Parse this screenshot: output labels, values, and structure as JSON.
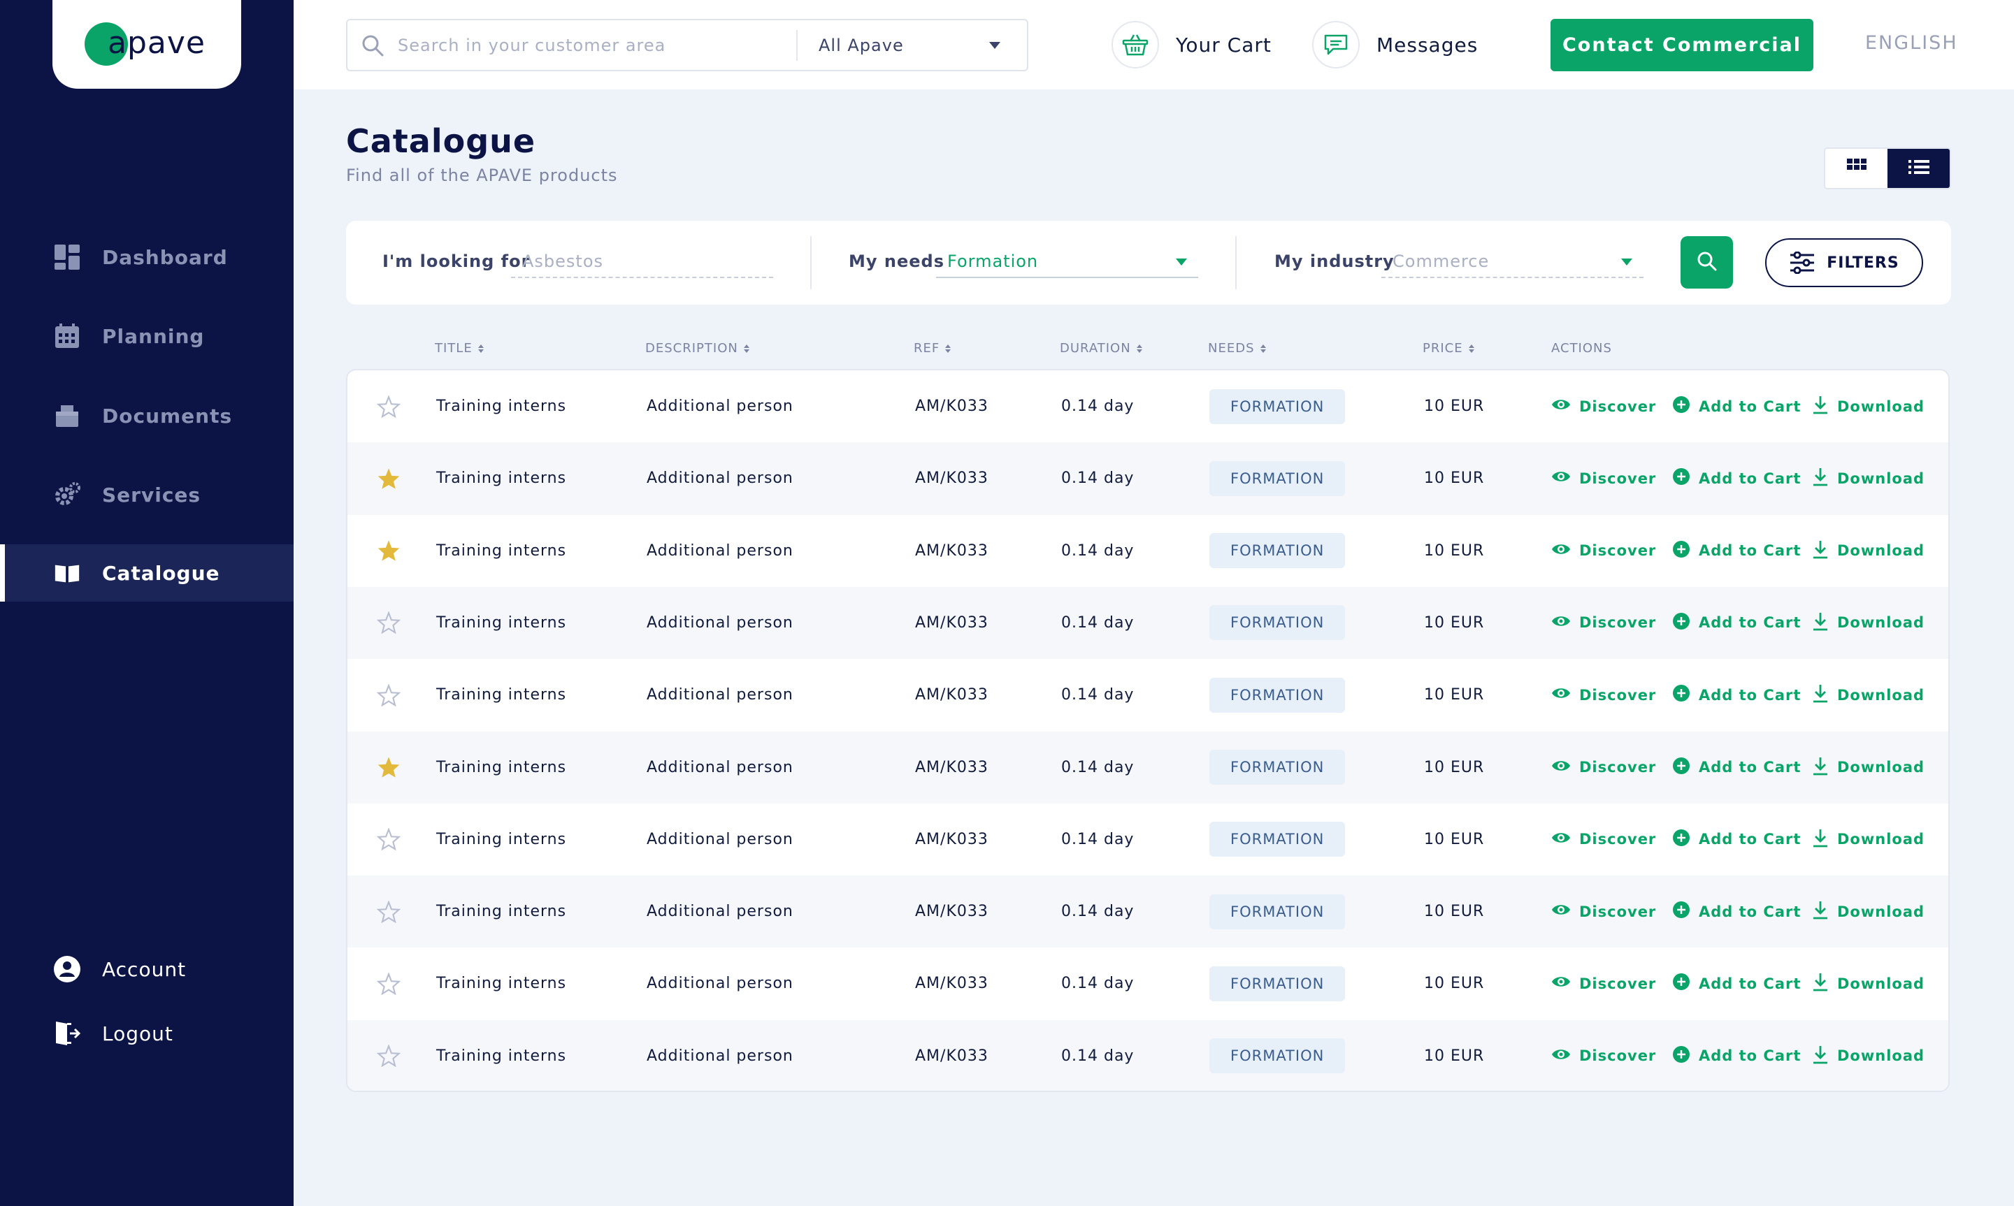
{
  "brand": {
    "logo_text": "apave"
  },
  "sidebar": {
    "items": [
      {
        "label": "Dashboard",
        "icon": "dashboard-icon"
      },
      {
        "label": "Planning",
        "icon": "calendar-icon"
      },
      {
        "label": "Documents",
        "icon": "documents-icon"
      },
      {
        "label": "Services",
        "icon": "gear-icon"
      },
      {
        "label": "Catalogue",
        "icon": "book-icon",
        "active": true
      }
    ],
    "bottom": [
      {
        "label": "Account",
        "icon": "user-icon"
      },
      {
        "label": "Logout",
        "icon": "logout-icon"
      }
    ]
  },
  "header": {
    "search_placeholder": "Search in your customer area",
    "scope": "All Apave",
    "cart_label": "Your Cart",
    "messages_label": "Messages",
    "contact_label": "Contact Commercial",
    "language": "ENGLISH"
  },
  "page": {
    "title": "Catalogue",
    "subtitle": "Find all of the APAVE products"
  },
  "filters": {
    "looking_label": "I'm looking for",
    "looking_placeholder": "Asbestos",
    "needs_label": "My needs",
    "needs_value": "Formation",
    "industry_label": "My industry",
    "industry_placeholder": "Commerce",
    "filters_label": "FILTERS"
  },
  "table": {
    "columns": {
      "title": "TITLE",
      "description": "DESCRIPTION",
      "ref": "REF",
      "duration": "DURATION",
      "needs": "NEEDS",
      "price": "PRICE",
      "actions": "ACTIONS"
    },
    "action_labels": {
      "discover": "Discover",
      "add": "Add to Cart",
      "download": "Download"
    },
    "rows": [
      {
        "starred": false,
        "title": "Training interns",
        "description": "Additional person",
        "ref": "AM/K033",
        "duration": "0.14 day",
        "needs": "FORMATION",
        "price": "10 EUR"
      },
      {
        "starred": true,
        "title": "Training interns",
        "description": "Additional person",
        "ref": "AM/K033",
        "duration": "0.14 day",
        "needs": "FORMATION",
        "price": "10 EUR"
      },
      {
        "starred": true,
        "title": "Training interns",
        "description": "Additional person",
        "ref": "AM/K033",
        "duration": "0.14 day",
        "needs": "FORMATION",
        "price": "10 EUR"
      },
      {
        "starred": false,
        "title": "Training interns",
        "description": "Additional person",
        "ref": "AM/K033",
        "duration": "0.14 day",
        "needs": "FORMATION",
        "price": "10 EUR"
      },
      {
        "starred": false,
        "title": "Training interns",
        "description": "Additional person",
        "ref": "AM/K033",
        "duration": "0.14 day",
        "needs": "FORMATION",
        "price": "10 EUR"
      },
      {
        "starred": true,
        "title": "Training interns",
        "description": "Additional person",
        "ref": "AM/K033",
        "duration": "0.14 day",
        "needs": "FORMATION",
        "price": "10 EUR"
      },
      {
        "starred": false,
        "title": "Training interns",
        "description": "Additional person",
        "ref": "AM/K033",
        "duration": "0.14 day",
        "needs": "FORMATION",
        "price": "10 EUR"
      },
      {
        "starred": false,
        "title": "Training interns",
        "description": "Additional person",
        "ref": "AM/K033",
        "duration": "0.14 day",
        "needs": "FORMATION",
        "price": "10 EUR"
      },
      {
        "starred": false,
        "title": "Training interns",
        "description": "Additional person",
        "ref": "AM/K033",
        "duration": "0.14 day",
        "needs": "FORMATION",
        "price": "10 EUR"
      },
      {
        "starred": false,
        "title": "Training interns",
        "description": "Additional person",
        "ref": "AM/K033",
        "duration": "0.14 day",
        "needs": "FORMATION",
        "price": "10 EUR"
      }
    ]
  },
  "colors": {
    "navy": "#0b1444",
    "green": "#0aa468",
    "star": "#e3b93b",
    "background": "#eef2f9"
  }
}
